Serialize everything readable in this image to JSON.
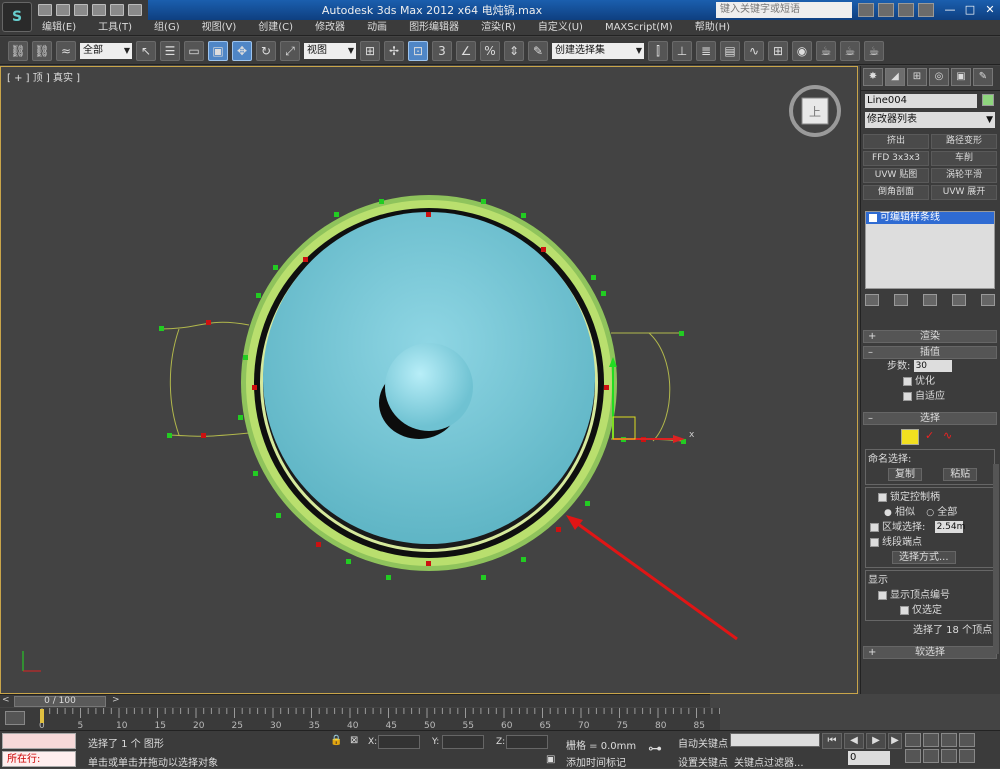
{
  "titlebar": {
    "title": "Autodesk 3ds Max  2012 x64    电炖锅.max",
    "search_placeholder": "键入关键字或短语"
  },
  "menu": [
    "编辑(E)",
    "工具(T)",
    "组(G)",
    "视图(V)",
    "创建(C)",
    "修改器",
    "动画",
    "图形编辑器",
    "渲染(R)",
    "自定义(U)",
    "MAXScript(M)",
    "帮助(H)"
  ],
  "toolbar": {
    "selection_filter": "全部",
    "ref_coord": "视图",
    "named_selection": "创建选择集"
  },
  "viewport": {
    "label": "[ + ] 顶 ] 真实 ]",
    "axis_x": "x",
    "cube_label": "上"
  },
  "command_panel": {
    "object_name": "Line004",
    "modifier_list": "修改器列表",
    "modifier_buttons": [
      "挤出",
      "路径变形",
      "FFD 3x3x3",
      "车削",
      "UVW 贴图",
      "涡轮平滑",
      "倒角剖面",
      "UVW 展开"
    ],
    "stack_item": "可编辑样条线",
    "rollout_render": "渲染",
    "rollout_interp": "插值",
    "steps_label": "步数:",
    "steps_value": "30",
    "optimize": "优化",
    "adaptive": "自适应",
    "rollout_select": "选择",
    "named_sel_label": "命名选择:",
    "copy_btn": "复制",
    "paste_btn": "粘贴",
    "lock_handles": "锁定控制柄",
    "alike": "相似",
    "all": "全部",
    "area_sel": "区域选择:",
    "area_value": "2.54m",
    "seg_end": "线段端点",
    "select_by": "选择方式...",
    "display": "显示",
    "show_vertex_num": "显示顶点编号",
    "only_selected": "仅选定",
    "selected_info": "选择了 18 个顶点",
    "soft_select": "软选择"
  },
  "timeline": {
    "frame_range": "0 / 100",
    "ticks": [
      "0",
      "5",
      "10",
      "15",
      "20",
      "25",
      "30",
      "35",
      "40",
      "45",
      "50",
      "55",
      "60",
      "65",
      "70",
      "75",
      "80",
      "85"
    ]
  },
  "status": {
    "running": "所在行:",
    "selected": "选择了 1 个 图形",
    "prompt": "单击或单击并拖动以选择对象",
    "x_label": "X:",
    "y_label": "Y:",
    "z_label": "Z:",
    "grid": "栅格 = 0.0mm",
    "add_time_tag": "添加时间标记",
    "auto_key": "自动关键点",
    "set_key": "设置关键点",
    "key_filters": "关键点过滤器...",
    "frame": "0"
  }
}
